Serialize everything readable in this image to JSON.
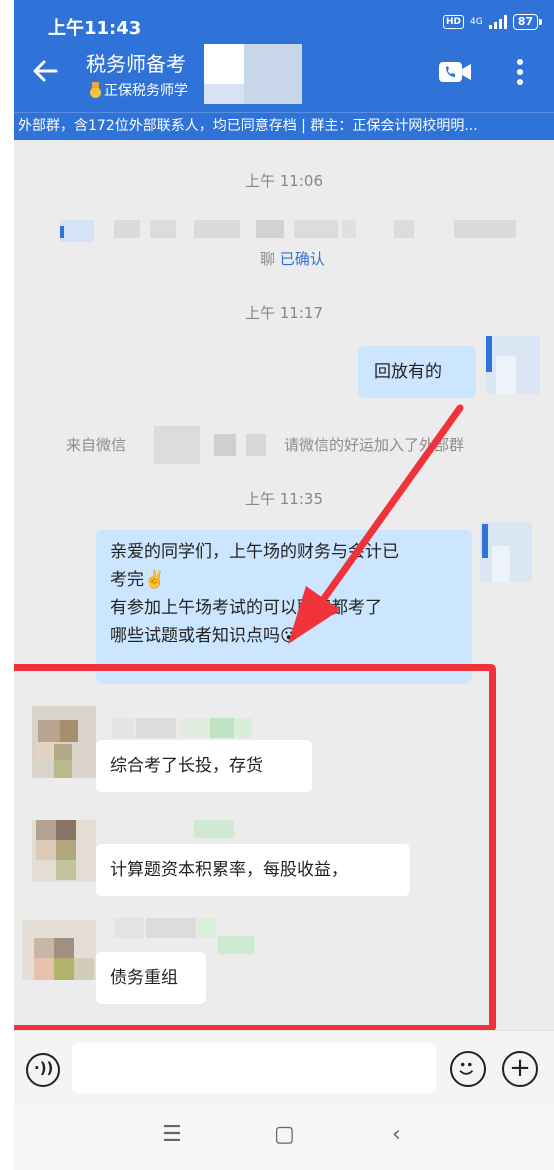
{
  "status_bar": {
    "time": "上午11:43",
    "hd_label": "HD",
    "network": "4G",
    "battery": "87"
  },
  "header": {
    "title": "税务师备考",
    "subtitle": "正保税务师学",
    "back_icon": "arrow-left-icon",
    "video_icon": "video-call-icon",
    "more_icon": "more-vertical-icon"
  },
  "group_notice": "外部群，含172位外部联系人，均已同意存档 | 群主：正保会计网校明明...",
  "messages": {
    "ts1": "上午 11:06",
    "confirm_prefix": "聊",
    "confirm_status": "已确认",
    "ts2": "上午 11:17",
    "reply1": "回放有的",
    "sys_left": "来自微信",
    "sys_right": "请微信的好运加入了外部群",
    "ts3": "上午 11:35",
    "announce_line1": "亲爱的同学们，上午场的财务与会计已",
    "announce_line2": "考完✌️",
    "announce_line3": "有参加上午场考试的可以聊聊都考了",
    "announce_line4": "哪些试题或者知识点吗😮",
    "chat1": "综合考了长投，存货",
    "chat2": "计算题资本积累率，每股收益，",
    "chat3": "债务重组"
  },
  "input_bar": {
    "voice_icon": "voice-icon",
    "emoji_icon": "emoji-icon",
    "plus_icon": "plus-icon"
  },
  "nav_bar": {
    "menu": "☰",
    "home": "▢",
    "back": "‹"
  },
  "colors": {
    "header_blue": "#2f72d8",
    "my_bubble": "#cde6ff",
    "annotation_red": "#f0323a",
    "confirm_blue": "#2f72d8"
  }
}
